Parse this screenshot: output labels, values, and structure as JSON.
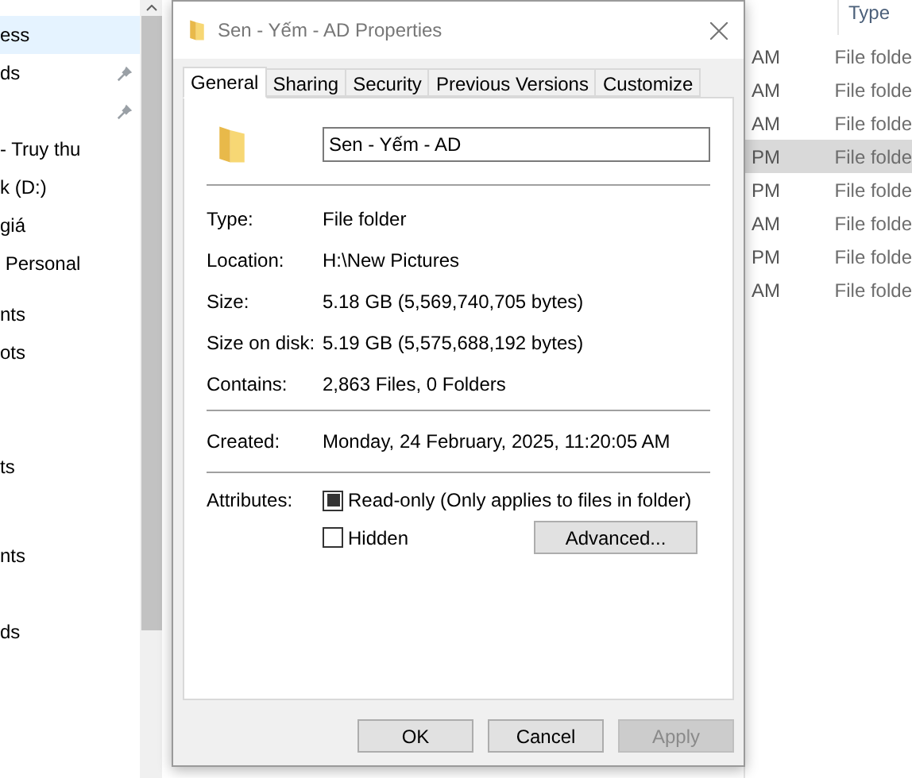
{
  "nav_pane": {
    "items": [
      {
        "label": "ess",
        "selected": true,
        "pinned": false
      },
      {
        "label": "ds",
        "selected": false,
        "pinned": true
      },
      {
        "selected": false,
        "pinned": true
      },
      {
        "label": "- Truy thu",
        "selected": false,
        "pinned": false
      },
      {
        "label": "k (D:)",
        "selected": false,
        "pinned": false
      },
      {
        "label": "giá",
        "selected": false,
        "pinned": false
      },
      {
        "label": " Personal",
        "selected": false,
        "pinned": false
      },
      {
        "label": "nts",
        "selected": false,
        "pinned": false
      },
      {
        "label": "ots",
        "selected": false,
        "pinned": false
      },
      {
        "label": "ts",
        "selected": false,
        "pinned": false
      },
      {
        "label": "nts",
        "selected": false,
        "pinned": false
      },
      {
        "label": "ds",
        "selected": false,
        "pinned": false
      }
    ]
  },
  "file_list": {
    "column_header": "Type",
    "rows": [
      {
        "time": "AM",
        "type": "File folde",
        "selected": false
      },
      {
        "time": "AM",
        "type": "File folde",
        "selected": false
      },
      {
        "time": "AM",
        "type": "File folde",
        "selected": false
      },
      {
        "time": "PM",
        "type": "File folde",
        "selected": true
      },
      {
        "time": "PM",
        "type": "File folde",
        "selected": false
      },
      {
        "time": "AM",
        "type": "File folde",
        "selected": false
      },
      {
        "time": "PM",
        "type": "File folde",
        "selected": false
      },
      {
        "time": "AM",
        "type": "File folde",
        "selected": false
      }
    ]
  },
  "dialog": {
    "title": "Sen - Yếm - AD Properties",
    "tabs": [
      {
        "label": "General",
        "selected": true
      },
      {
        "label": "Sharing",
        "selected": false
      },
      {
        "label": "Security",
        "selected": false
      },
      {
        "label": "Previous Versions",
        "selected": false
      },
      {
        "label": "Customize",
        "selected": false
      }
    ],
    "name_field": {
      "value": "Sen - Yếm - AD"
    },
    "properties": [
      {
        "label": "Type:",
        "value": "File folder"
      },
      {
        "label": "Location:",
        "value": "H:\\New Pictures"
      },
      {
        "label": "Size:",
        "value": "5.18 GB (5,569,740,705 bytes)"
      },
      {
        "label": "Size on disk:",
        "value": "5.19 GB (5,575,688,192 bytes)"
      },
      {
        "label": "Contains:",
        "value": "2,863 Files, 0 Folders"
      }
    ],
    "created": {
      "label": "Created:",
      "value": "Monday, 24 February, 2025, 11:20:05 AM"
    },
    "attributes": {
      "label": "Attributes:",
      "read_only": {
        "label": "Read-only (Only applies to files in folder)",
        "checked": true
      },
      "hidden": {
        "label": "Hidden",
        "checked": false
      },
      "advanced_button": "Advanced..."
    },
    "buttons": [
      {
        "label": "OK",
        "disabled": false
      },
      {
        "label": "Cancel",
        "disabled": false
      },
      {
        "label": "Apply",
        "disabled": true
      }
    ]
  }
}
